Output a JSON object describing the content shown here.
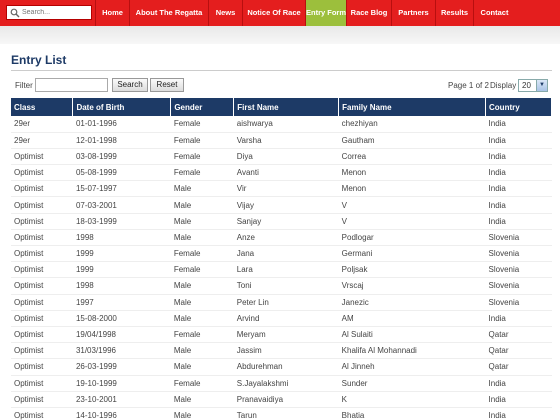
{
  "search": {
    "placeholder": "Search...",
    "icon": "search-icon"
  },
  "nav": [
    {
      "label": "Home",
      "active": false
    },
    {
      "label": "About The Regatta",
      "active": false
    },
    {
      "label": "News",
      "active": false
    },
    {
      "label": "Notice Of Race",
      "active": false
    },
    {
      "label": "Entry Form",
      "active": true
    },
    {
      "label": "Race Blog",
      "active": false
    },
    {
      "label": "Partners",
      "active": false
    },
    {
      "label": "Results",
      "active": false
    },
    {
      "label": "Contact",
      "active": false
    }
  ],
  "page": {
    "title": "Entry List"
  },
  "filter": {
    "label": "Filter",
    "value": "",
    "search_label": "Search",
    "reset_label": "Reset"
  },
  "pagination": {
    "info": "Page 1 of 2",
    "display_label": "Display",
    "display_value": "20"
  },
  "table": {
    "headers": [
      "Class",
      "Date of Birth",
      "Gender",
      "First Name",
      "Family Name",
      "Country"
    ],
    "rows": [
      [
        "29er",
        "01-01-1996",
        "Female",
        "aishwarya",
        "chezhiyan",
        "India"
      ],
      [
        "29er",
        "12-01-1998",
        "Female",
        "Varsha",
        "Gautham",
        "India"
      ],
      [
        "Optimist",
        "03-08-1999",
        "Female",
        "Diya",
        "Correa",
        "India"
      ],
      [
        "Optimist",
        "05-08-1999",
        "Female",
        "Avanti",
        "Menon",
        "India"
      ],
      [
        "Optimist",
        "15-07-1997",
        "Male",
        "Vir",
        "Menon",
        "India"
      ],
      [
        "Optimist",
        "07-03-2001",
        "Male",
        "Vijay",
        "V",
        "India"
      ],
      [
        "Optimist",
        "18-03-1999",
        "Male",
        "Sanjay",
        "V",
        "India"
      ],
      [
        "Optimist",
        "1998",
        "Male",
        "Anze",
        "Podlogar",
        "Slovenia"
      ],
      [
        "Optimist",
        "1999",
        "Female",
        "Jana",
        "Germani",
        "Slovenia"
      ],
      [
        "Optimist",
        "1999",
        "Female",
        "Lara",
        "Poljsak",
        "Slovenia"
      ],
      [
        "Optimist",
        "1998",
        "Male",
        "Toni",
        "Vrscaj",
        "Slovenia"
      ],
      [
        "Optimist",
        "1997",
        "Male",
        "Peter Lin",
        "Janezic",
        "Slovenia"
      ],
      [
        "Optimist",
        "15-08-2000",
        "Male",
        "Arvind",
        "AM",
        "India"
      ],
      [
        "Optimist",
        "19/04/1998",
        "Female",
        "Meryam",
        "Al Sulaiti",
        "Qatar"
      ],
      [
        "Optimist",
        "31/03/1996",
        "Male",
        "Jassim",
        "Khalifa Al Mohannadi",
        "Qatar"
      ],
      [
        "Optimist",
        "26-03-1999",
        "Male",
        "Abdurehman",
        "Al Jinneh",
        "Qatar"
      ],
      [
        "Optimist",
        "19-10-1999",
        "Female",
        "S.Jayalakshmi",
        "Sunder",
        "India"
      ],
      [
        "Optimist",
        "23-10-2001",
        "Male",
        "Pranavaidiya",
        "K",
        "India"
      ],
      [
        "Optimist",
        "14-10-1996",
        "Male",
        "Tarun",
        "Bhatia",
        "India"
      ]
    ]
  }
}
